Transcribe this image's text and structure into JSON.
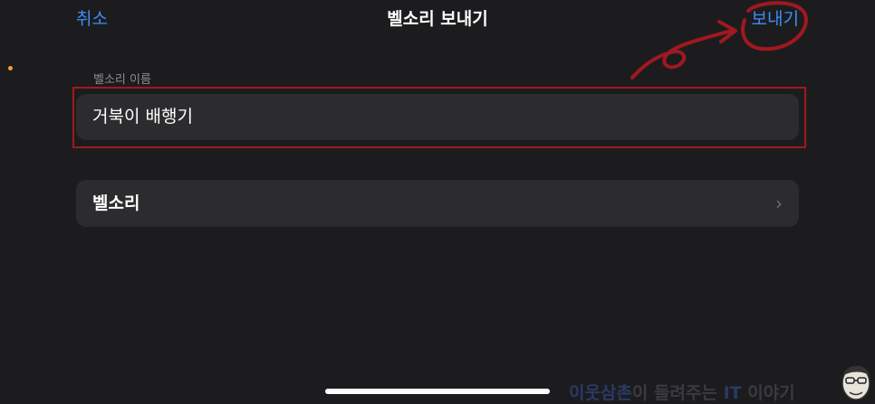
{
  "nav": {
    "cancel_label": "취소",
    "title": "벨소리 보내기",
    "send_label": "보내기"
  },
  "form": {
    "name_label": "벨소리 이름",
    "name_value": "거북이 배행기",
    "ringtone_label": "벨소리",
    "chevron": "›"
  },
  "watermark": {
    "part1": "이웃삼촌",
    "part2": "이 들려주는 ",
    "part3": "IT",
    "part4": " 이야기"
  },
  "colors": {
    "accent": "#3d8ef7",
    "annotation": "#a01820",
    "background": "#1c1c1e",
    "cell": "#2c2c2e"
  },
  "icons": {
    "chevron": "chevron-right-icon",
    "mascot": "mascot-face-icon"
  }
}
